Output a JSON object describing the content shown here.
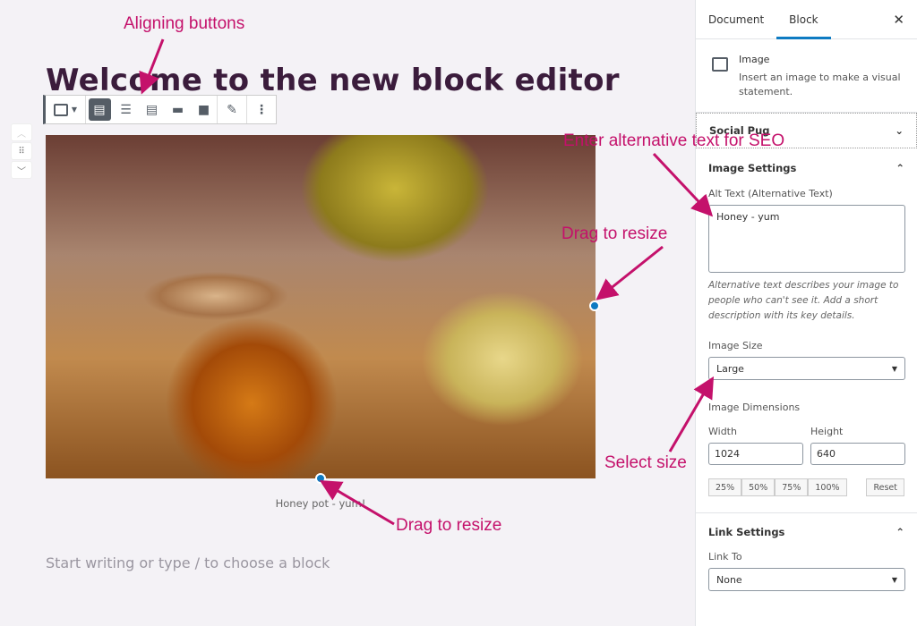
{
  "editor": {
    "title": "Welcome to the new block editor",
    "caption": "Honey pot - yum!",
    "placeholder": "Start writing or type / to choose a block"
  },
  "toolbar": {
    "buttons": [
      {
        "icon": "image-icon"
      },
      {
        "icon": "align-left-icon",
        "active": true
      },
      {
        "icon": "align-center-icon"
      },
      {
        "icon": "align-right-icon"
      },
      {
        "icon": "wide-width-icon"
      },
      {
        "icon": "full-width-icon"
      },
      {
        "icon": "pencil-icon"
      },
      {
        "icon": "more-options-icon"
      }
    ]
  },
  "annotations": {
    "aligning": "Aligning buttons",
    "alt": "Enter alternative text for SEO",
    "drag1": "Drag to resize",
    "select": "Select size",
    "drag2": "Drag to resize",
    "color": "#c4116b"
  },
  "sidebar": {
    "tabs": [
      "Document",
      "Block"
    ],
    "active_tab": "Block",
    "close": "✕",
    "block": {
      "name": "Image",
      "description": "Insert an image to make a visual statement."
    },
    "social": "Social Pug",
    "image_settings": {
      "title": "Image Settings",
      "alt_label": "Alt Text (Alternative Text)",
      "alt_value": "Honey - yum",
      "help": "Alternative text describes your image to people who can't see it. Add a short description with its key details.",
      "size_label": "Image Size",
      "size_value": "Large",
      "dims_label": "Image Dimensions",
      "width_label": "Width",
      "width": "1024",
      "height_label": "Height",
      "height": "640",
      "percent": [
        "25%",
        "50%",
        "75%",
        "100%"
      ],
      "reset": "Reset"
    },
    "link_settings": {
      "title": "Link Settings",
      "link_label": "Link To",
      "link_value": "None"
    }
  },
  "colors": {
    "accent": "#0e7bc2",
    "title": "#3b1c3c"
  }
}
